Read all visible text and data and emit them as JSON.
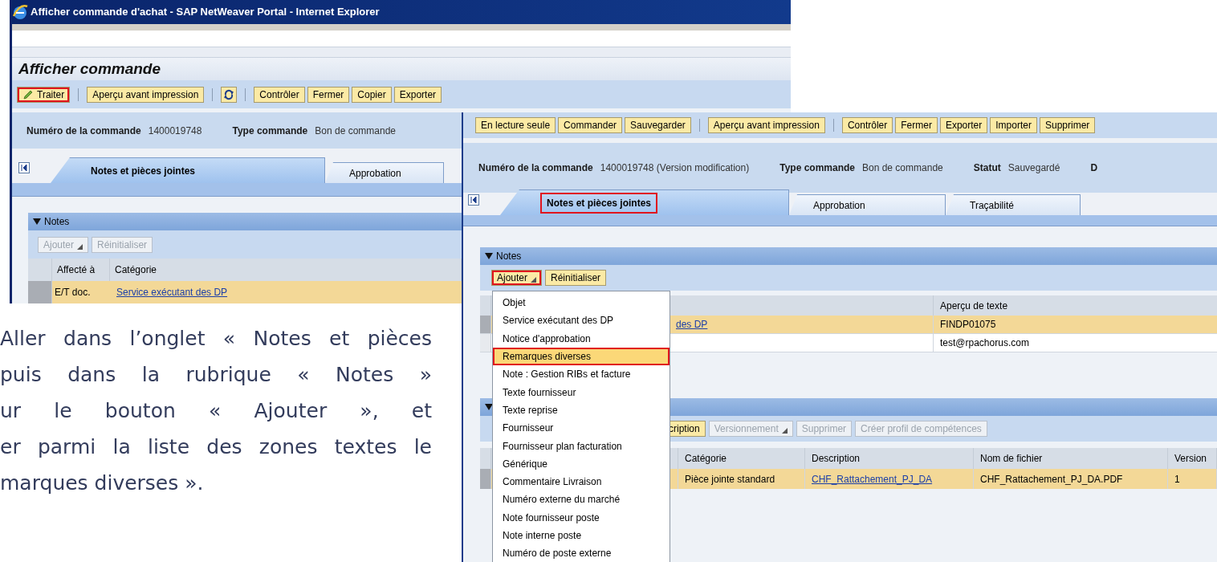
{
  "window_a": {
    "title": "Afficher commande d'achat - SAP NetWeaver Portal - Internet Explorer",
    "page_title": "Afficher commande",
    "toolbar": [
      {
        "kind": "edit",
        "label": "Traiter",
        "highlighted": true
      },
      {
        "kind": "separator"
      },
      {
        "kind": "button",
        "label": "Aperçu avant impression",
        "highlighted": false
      },
      {
        "kind": "separator"
      },
      {
        "kind": "refresh"
      },
      {
        "kind": "separator"
      },
      {
        "kind": "button",
        "label": "Contrôler",
        "highlighted": false
      },
      {
        "kind": "button",
        "label": "Fermer",
        "highlighted": false
      },
      {
        "kind": "button",
        "label": "Copier",
        "highlighted": false
      },
      {
        "kind": "button",
        "label": "Exporter",
        "highlighted": false
      }
    ],
    "fields": [
      {
        "label": "Numéro de la commande",
        "value": "1400019748"
      },
      {
        "label": "Type commande",
        "value": "Bon de commande"
      }
    ],
    "tabs": [
      {
        "label": "Notes et pièces jointes",
        "selected": true,
        "highlighted": false
      },
      {
        "label": "Approbation",
        "selected": false,
        "highlighted": false
      }
    ],
    "notes": {
      "title": "Notes",
      "expanded": true,
      "buttons": [
        {
          "label": "Ajouter",
          "disabled": true,
          "dropdown": true,
          "highlighted": false
        },
        {
          "label": "Réinitialiser",
          "disabled": true,
          "dropdown": false,
          "highlighted": false
        }
      ],
      "columns": [
        "Affecté à",
        "Catégorie"
      ],
      "rows": [
        {
          "selected": true,
          "assigned": "E/T doc.",
          "category": "Service exécutant des DP"
        }
      ]
    }
  },
  "window_b": {
    "toolbar": [
      {
        "kind": "button",
        "label": "En lecture seule",
        "highlighted": false
      },
      {
        "kind": "button",
        "label": "Commander",
        "highlighted": false
      },
      {
        "kind": "button",
        "label": "Sauvegarder",
        "highlighted": false
      },
      {
        "kind": "separator"
      },
      {
        "kind": "button",
        "label": "Aperçu avant impression",
        "highlighted": false
      },
      {
        "kind": "separator"
      },
      {
        "kind": "button",
        "label": "Contrôler",
        "highlighted": false
      },
      {
        "kind": "button",
        "label": "Fermer",
        "highlighted": false
      },
      {
        "kind": "button",
        "label": "Exporter",
        "highlighted": false
      },
      {
        "kind": "button",
        "label": "Importer",
        "highlighted": false
      },
      {
        "kind": "button",
        "label": "Supprimer",
        "highlighted": false
      }
    ],
    "fields": [
      {
        "label": "Numéro de la commande",
        "value": "1400019748 (Version modification)"
      },
      {
        "label": "Type commande",
        "value": "Bon de commande"
      },
      {
        "label": "Statut",
        "value": "Sauvegardé"
      },
      {
        "label": "D"
      }
    ],
    "tabs": [
      {
        "label": "Notes et pièces jointes",
        "selected": true,
        "highlighted": true
      },
      {
        "label": "Approbation",
        "selected": false,
        "highlighted": false
      },
      {
        "label": "Traçabilité",
        "selected": false,
        "highlighted": false
      }
    ],
    "notes": {
      "title": "Notes",
      "expanded": true,
      "buttons": [
        {
          "label": "Ajouter",
          "disabled": false,
          "dropdown": true,
          "highlighted": true
        },
        {
          "label": "Réinitialiser",
          "disabled": false,
          "dropdown": false,
          "highlighted": false
        }
      ],
      "columns": [
        "Aperçu de texte"
      ],
      "rows": [
        {
          "selected": true,
          "category": "des DP",
          "preview": "FINDP01075"
        },
        {
          "selected": false,
          "preview": "test@rpachorus.com"
        }
      ]
    },
    "attachments": {
      "expanded": true,
      "buttons": [
        {
          "label": "cription",
          "disabled": false,
          "dropdown": false,
          "highlighted": false
        },
        {
          "label": "Versionnement",
          "disabled": true,
          "dropdown": true,
          "highlighted": false
        },
        {
          "label": "Supprimer",
          "disabled": true,
          "dropdown": false,
          "highlighted": false
        },
        {
          "label": "Créer profil de compétences",
          "disabled": true,
          "dropdown": false,
          "highlighted": false
        }
      ],
      "columns": [
        "Catégorie",
        "Description",
        "Nom de fichier",
        "Version"
      ],
      "rows": [
        {
          "selected": true,
          "cells": [
            {
              "kind": "text",
              "text": "Pièce jointe standard"
            },
            {
              "kind": "link",
              "text": "CHF_Rattachement_PJ_DA"
            },
            {
              "kind": "text",
              "text": "CHF_Rattachement_PJ_DA.PDF"
            },
            {
              "kind": "text",
              "text": "1"
            }
          ]
        }
      ]
    },
    "menu": [
      {
        "label": "Objet",
        "selected": false
      },
      {
        "label": "Service exécutant des DP",
        "selected": false
      },
      {
        "label": "Notice d'approbation",
        "selected": false
      },
      {
        "label": "Remarques diverses",
        "selected": true
      },
      {
        "label": "Note : Gestion RIBs et facture",
        "selected": false
      },
      {
        "label": "Texte fournisseur",
        "selected": false
      },
      {
        "label": "Texte reprise",
        "selected": false
      },
      {
        "label": "Fournisseur",
        "selected": false
      },
      {
        "label": "Fournisseur plan facturation",
        "selected": false
      },
      {
        "label": "Générique",
        "selected": false
      },
      {
        "label": "Commentaire Livraison",
        "selected": false
      },
      {
        "label": "Numéro externe du marché",
        "selected": false
      },
      {
        "label": "Note fournisseur poste",
        "selected": false
      },
      {
        "label": "Note interne poste",
        "selected": false
      },
      {
        "label": "Numéro de poste externe",
        "selected": false
      }
    ]
  },
  "instruction_lines": [
    "Aller dans l’onglet « Notes et pièces",
    "puis dans la rubrique « Notes »",
    "ur le bouton « Ajouter », et",
    "er parmi la liste des zones textes le",
    "marques diverses »."
  ]
}
